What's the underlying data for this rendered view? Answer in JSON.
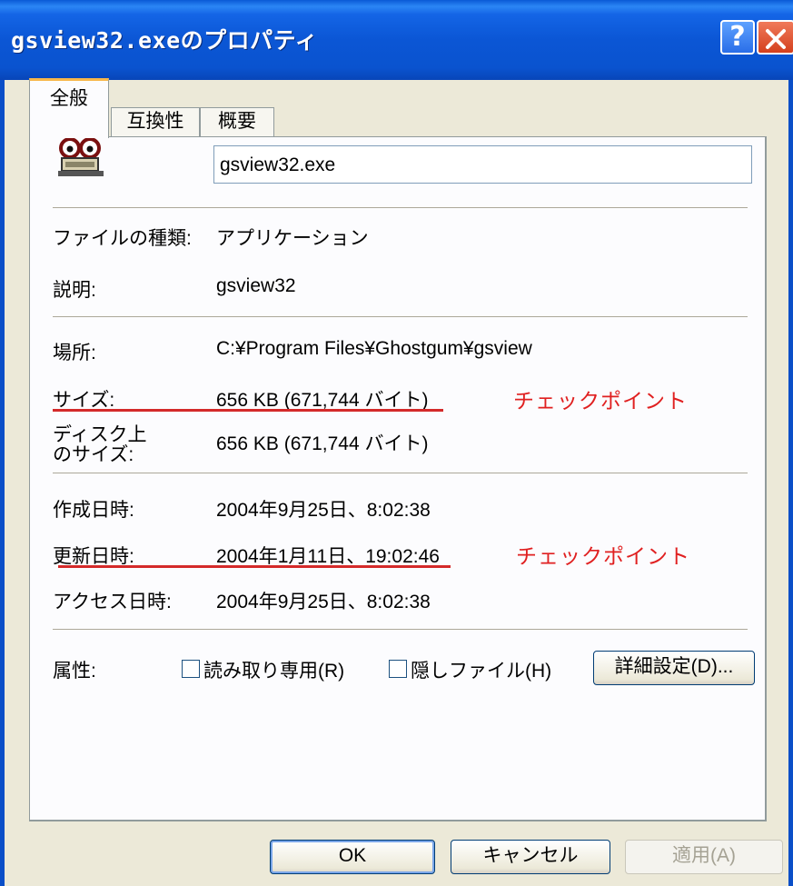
{
  "window": {
    "title": "gsview32.exeのプロパティ",
    "help_label": "?",
    "accent_color": "#0a53cf"
  },
  "tabs": [
    {
      "label": "全般",
      "active": true
    },
    {
      "label": "互換性",
      "active": false
    },
    {
      "label": "概要",
      "active": false
    }
  ],
  "general": {
    "file_icon": "ghostscript-app-icon",
    "file_name": "gsview32.exe",
    "rows": {
      "file_type": {
        "label": "ファイルの種類:",
        "value": "アプリケーション"
      },
      "description": {
        "label": "説明:",
        "value": "gsview32"
      },
      "location": {
        "label": "場所:",
        "value": "C:¥Program Files¥Ghostgum¥gsview"
      },
      "size": {
        "label": "サイズ:",
        "value": "656 KB (671,744 バイト)"
      },
      "size_on_disk": {
        "label_line1": "ディスク上",
        "label_line2": "のサイズ:",
        "value": "656 KB (671,744 バイト)"
      },
      "created": {
        "label": "作成日時:",
        "value": "2004年9月25日、8:02:38"
      },
      "modified": {
        "label": "更新日時:",
        "value": "2004年1月11日、19:02:46"
      },
      "accessed": {
        "label": "アクセス日時:",
        "value": "2004年9月25日、8:02:38"
      }
    },
    "attributes": {
      "label": "属性:",
      "readonly_label": "読み取り専用(R)",
      "readonly_checked": false,
      "hidden_label": "隠しファイル(H)",
      "hidden_checked": false,
      "advanced_button": "詳細設定(D)..."
    },
    "annotations": {
      "checkpoint_1": "チェックポイント",
      "checkpoint_2": "チェックポイント",
      "highlight_color": "#d42a2a"
    }
  },
  "buttons": {
    "ok": "OK",
    "cancel": "キャンセル",
    "apply": "適用(A)"
  }
}
